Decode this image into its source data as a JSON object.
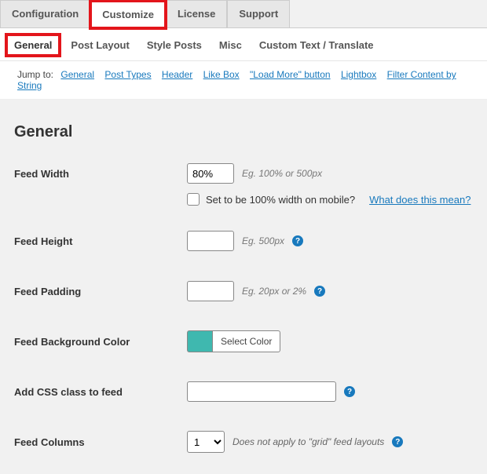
{
  "tabs_primary": [
    {
      "label": "Configuration"
    },
    {
      "label": "Customize"
    },
    {
      "label": "License"
    },
    {
      "label": "Support"
    }
  ],
  "tabs_secondary": [
    {
      "label": "General"
    },
    {
      "label": "Post Layout"
    },
    {
      "label": "Style Posts"
    },
    {
      "label": "Misc"
    },
    {
      "label": "Custom Text / Translate"
    }
  ],
  "jump": {
    "lead": "Jump to:",
    "links": [
      "General",
      "Post Types",
      "Header",
      "Like Box",
      "\"Load More\" button",
      "Lightbox",
      "Filter Content by String"
    ]
  },
  "section": {
    "title": "General"
  },
  "feed_width": {
    "label": "Feed Width",
    "value": "80%",
    "hint": "Eg. 100% or 500px"
  },
  "mobile": {
    "cb_label": "Set to be 100% width on mobile?",
    "link": "What does this mean?"
  },
  "feed_height": {
    "label": "Feed Height",
    "value": "",
    "hint": "Eg. 500px"
  },
  "feed_padding": {
    "label": "Feed Padding",
    "value": "",
    "hint": "Eg. 20px or 2%"
  },
  "bgcolor": {
    "label": "Feed Background Color",
    "button": "Select Color",
    "swatch": "#3fb8af"
  },
  "cssclass": {
    "label": "Add CSS class to feed",
    "value": ""
  },
  "columns": {
    "label": "Feed Columns",
    "value": "1",
    "hint": "Does not apply to \"grid\" feed layouts"
  }
}
